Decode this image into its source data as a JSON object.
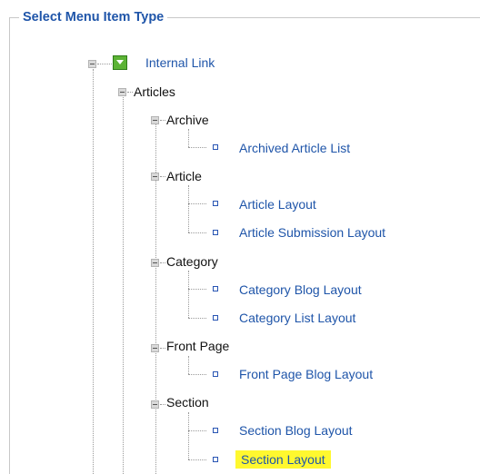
{
  "legend": "Select Menu Item Type",
  "root": {
    "label": "Internal Link",
    "icon": "expand-green-icon"
  },
  "group": {
    "label": "Articles"
  },
  "categories": [
    {
      "label": "Archive",
      "items": [
        {
          "label": "Archived Article List"
        }
      ]
    },
    {
      "label": "Article",
      "items": [
        {
          "label": "Article Layout"
        },
        {
          "label": "Article Submission Layout"
        }
      ]
    },
    {
      "label": "Category",
      "items": [
        {
          "label": "Category Blog Layout"
        },
        {
          "label": "Category List Layout"
        }
      ]
    },
    {
      "label": "Front Page",
      "items": [
        {
          "label": "Front Page Blog Layout"
        }
      ]
    },
    {
      "label": "Section",
      "items": [
        {
          "label": "Section Blog Layout"
        },
        {
          "label": "Section Layout",
          "highlighted": true
        }
      ]
    }
  ],
  "colors": {
    "link": "#1f55a9",
    "highlight": "#fff82f",
    "expand_icon": "#5cb335"
  }
}
